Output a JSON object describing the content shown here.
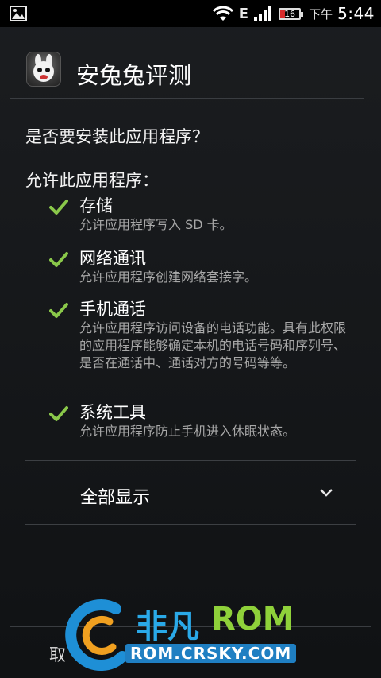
{
  "status_bar": {
    "network_type": "E",
    "battery_level": "16",
    "battery_color": "#d62a2a",
    "ampm": "下午",
    "time": "5:44"
  },
  "header": {
    "app_title": "安兔兔评测"
  },
  "install": {
    "question": "是否要安装此应用程序？",
    "allow_label": "允许此应用程序：",
    "permissions": [
      {
        "title": "存储",
        "desc": "允许应用程序写入 SD 卡。"
      },
      {
        "title": "网络通讯",
        "desc": "允许应用程序创建网络套接字。"
      },
      {
        "title": "手机通话",
        "desc": "允许应用程序访问设备的电话功能。具有此权限的应用程序能够确定本机的电话号码和序列号、是否在通话中、通话对方的号码等等。"
      },
      {
        "title": "系统工具",
        "desc": "允许应用程序防止手机进入休眠状态。"
      }
    ],
    "show_all_label": "全部显示",
    "check_color": "#8ac84a"
  },
  "footer": {
    "cancel_label": "取"
  },
  "watermark": {
    "brand_cn": "非凡",
    "brand_en": "ROM",
    "url": "ROM.CRSKY.COM"
  }
}
